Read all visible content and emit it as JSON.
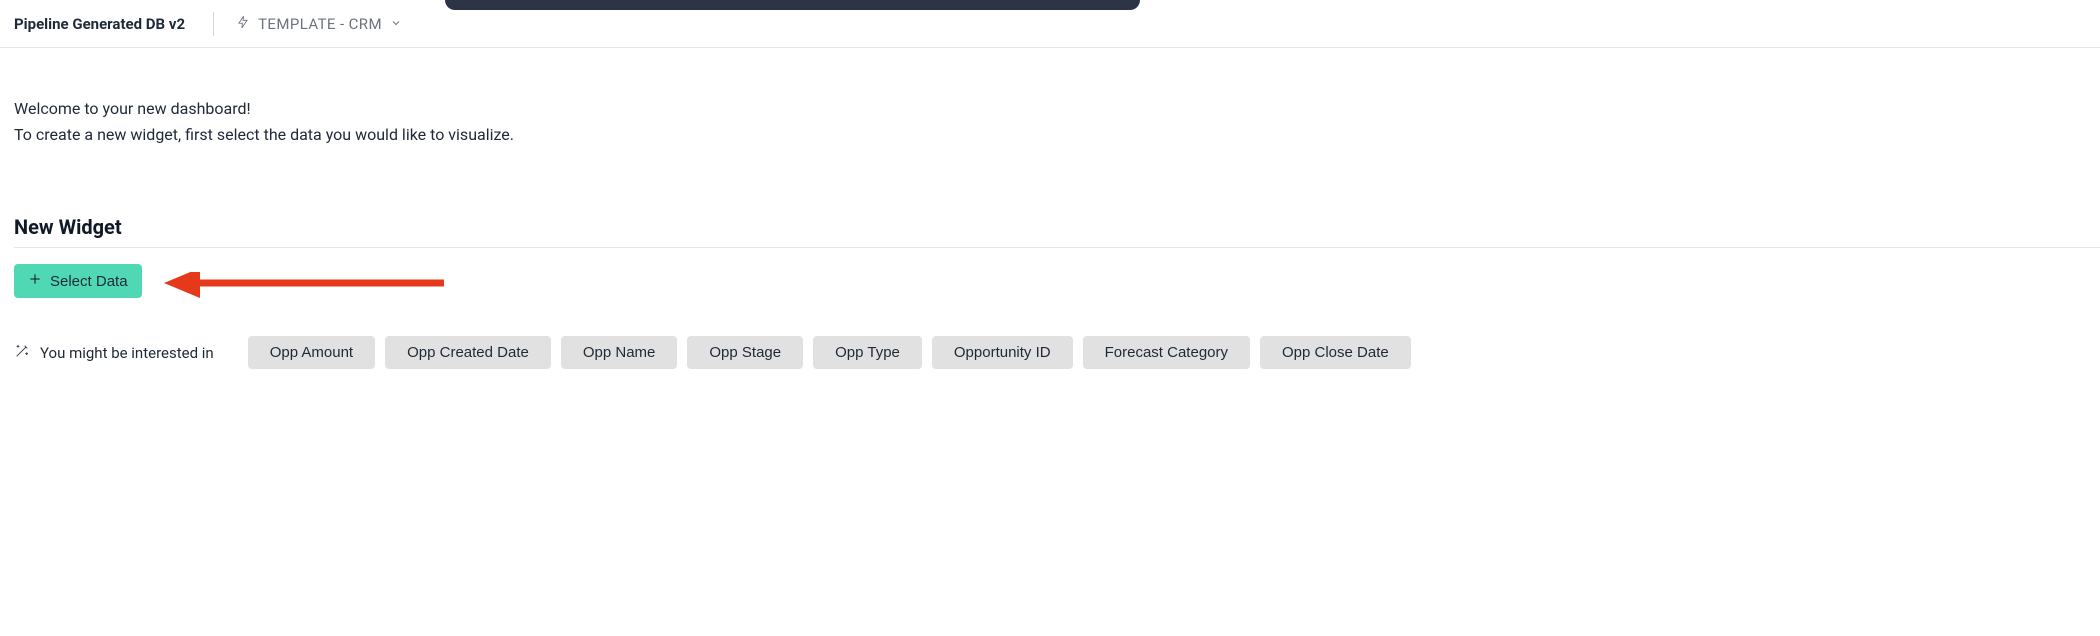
{
  "header": {
    "title": "Pipeline Generated DB v2",
    "template_label": "TEMPLATE - CRM"
  },
  "welcome": {
    "line1": "Welcome to your new dashboard!",
    "line2": "To create a new widget, first select the data you would like to visualize."
  },
  "widget": {
    "title": "New Widget",
    "select_data_label": "Select Data"
  },
  "suggestions": {
    "hint": "You might be interested in",
    "chips": [
      "Opp Amount",
      "Opp Created Date",
      "Opp Name",
      "Opp Stage",
      "Opp Type",
      "Opportunity ID",
      "Forecast Category",
      "Opp Close Date"
    ]
  }
}
